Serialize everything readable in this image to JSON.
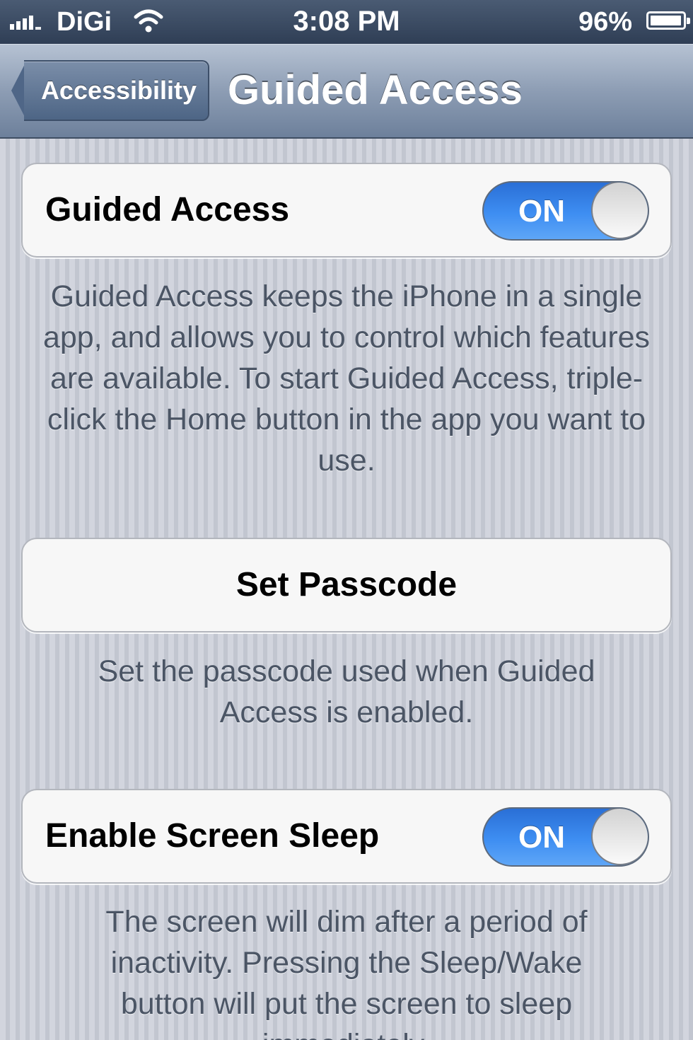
{
  "status_bar": {
    "carrier": "DiGi",
    "time": "3:08 PM",
    "battery": "96%",
    "icons": [
      "signal-icon",
      "wifi-icon",
      "battery-icon"
    ]
  },
  "nav": {
    "back_label": "Accessibility",
    "title": "Guided Access"
  },
  "sections": {
    "guided_access": {
      "label": "Guided Access",
      "toggle": "ON",
      "footer": "Guided Access keeps the iPhone in a single app, and allows you to control which features are available. To start Guided Access, triple-click the Home button in the app you want to use."
    },
    "passcode": {
      "label": "Set Passcode",
      "footer": "Set the passcode used when Guided Access is enabled."
    },
    "screen_sleep": {
      "label": "Enable Screen Sleep",
      "toggle": "ON",
      "footer": "The screen will dim after a period of inactivity. Pressing the Sleep/Wake button will put the screen to sleep immediately."
    }
  },
  "colors": {
    "toggle_on": "#3e8ef2",
    "nav_bar": "#8d9db4",
    "status_bar": "#2f3e55"
  }
}
